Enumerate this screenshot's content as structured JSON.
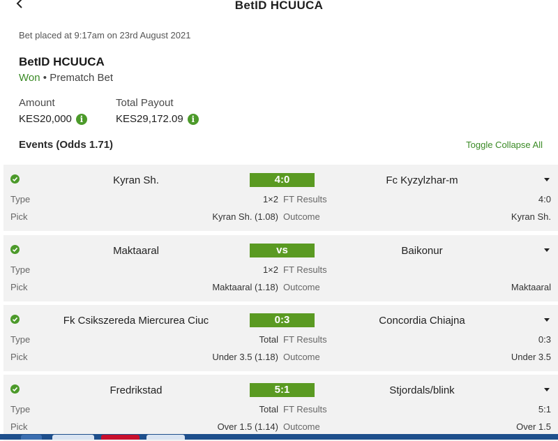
{
  "header": {
    "title": "BetID HCUUCA"
  },
  "bet": {
    "placed": "Bet placed at 9:17am on 23rd August 2021",
    "id_title": "BetID HCUUCA",
    "status": "Won",
    "separator": "•",
    "bet_type": "Prematch Bet",
    "amount_label": "Amount",
    "amount_value": "KES20,000",
    "payout_label": "Total Payout",
    "payout_value": "KES29,172.09"
  },
  "events": {
    "title": "Events (Odds 1.71)",
    "toggle_label": "Toggle Collapse All",
    "type_label": "Type",
    "pick_label": "Pick",
    "items": [
      {
        "home": "Kyran Sh.",
        "score": "4:0",
        "away": "Fc Kyzylzhar-m",
        "type_value": "1×2",
        "market": "FT Results",
        "result": "4:0",
        "pick_value": "Kyran Sh. (1.08)",
        "outcome_label": "Outcome",
        "outcome": "Kyran Sh."
      },
      {
        "home": "Maktaaral",
        "score": "vs",
        "away": "Baikonur",
        "type_value": "1×2",
        "market": "FT Results",
        "result": "",
        "pick_value": "Maktaaral (1.18)",
        "outcome_label": "Outcome",
        "outcome": "Maktaaral"
      },
      {
        "home": "Fk Csikszereda Miercurea Ciuc",
        "score": "0:3",
        "away": "Concordia Chiajna",
        "type_value": "Total",
        "market": "FT Results",
        "result": "0:3",
        "pick_value": "Under 3.5 (1.18)",
        "outcome_label": "Outcome",
        "outcome": "Under 3.5"
      },
      {
        "home": "Fredrikstad",
        "score": "5:1",
        "away": "Stjordals/blink",
        "type_value": "Total",
        "market": "FT Results",
        "result": "5:1",
        "pick_value": "Over 1.5 (1.14)",
        "outcome_label": "Outcome",
        "outcome": "Over 1.5"
      }
    ]
  },
  "colors": {
    "accent_green": "#3a8a25",
    "score_bg": "#5a9a22",
    "card_bg": "#f2f2f2"
  },
  "icons": {
    "back": "back-chevron-icon",
    "info": "info-icon",
    "check": "check-circle-icon",
    "caret": "caret-down-icon"
  }
}
